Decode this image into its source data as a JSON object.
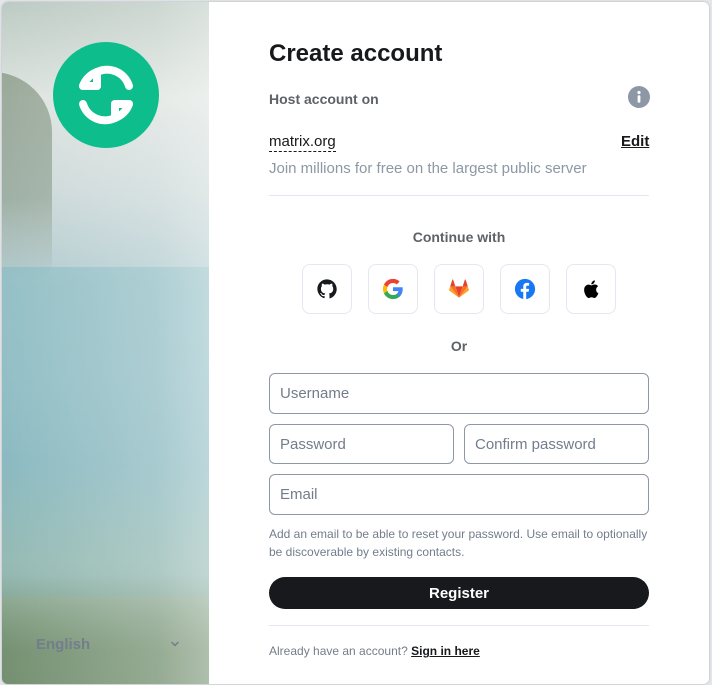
{
  "language": {
    "selected": "English"
  },
  "page": {
    "title": "Create account"
  },
  "host": {
    "label": "Host account on",
    "server": "matrix.org",
    "edit_label": "Edit",
    "description": "Join millions for free on the largest public server"
  },
  "sso": {
    "heading": "Continue with",
    "providers": [
      {
        "name": "GitHub",
        "icon": "github-icon"
      },
      {
        "name": "Google",
        "icon": "google-icon"
      },
      {
        "name": "GitLab",
        "icon": "gitlab-icon"
      },
      {
        "name": "Facebook",
        "icon": "facebook-icon"
      },
      {
        "name": "Apple",
        "icon": "apple-icon"
      }
    ]
  },
  "divider_text": "Or",
  "form": {
    "username": {
      "placeholder": "Username",
      "value": ""
    },
    "password": {
      "placeholder": "Password",
      "value": ""
    },
    "confirm_password": {
      "placeholder": "Confirm password",
      "value": ""
    },
    "email": {
      "placeholder": "Email",
      "value": ""
    },
    "email_hint": "Add an email to be able to reset your password. Use email to optionally be discoverable by existing contacts.",
    "register_label": "Register"
  },
  "footer": {
    "prompt": "Already have an account?",
    "signin_label": "Sign in here"
  },
  "colors": {
    "brand": "#0dbd8b",
    "primary_text": "#17191c",
    "secondary_text": "#737d8c",
    "border": "#8d97a5",
    "button_bg": "#17191c"
  }
}
